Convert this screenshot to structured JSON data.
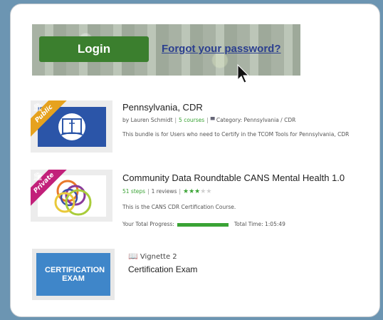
{
  "banner": {
    "login_label": "Login",
    "forgot_label": "Forgot your password?"
  },
  "courses": [
    {
      "ribbon": "Public",
      "title": "Pennsylvania, CDR",
      "author": "by Lauren Schmidt",
      "courses_count": "5 courses",
      "category": "Category: Pennsylvania / CDR",
      "description": "This bundle is for Users who need to Certify in the TCOM Tools for Pennsylvania, CDR"
    },
    {
      "ribbon": "Private",
      "title": "Community Data Roundtable CANS Mental Health 1.0",
      "steps": "51 steps",
      "reviews": "1 reviews",
      "rating": 3,
      "rating_max": 5,
      "description": "This is the CANS CDR Certification Course.",
      "progress_label": "Your Total Progress:",
      "progress": 1.0,
      "time_label": "Total Time: 1:05:49"
    },
    {
      "thumb_text": "CERTIFICATION EXAM",
      "type_label": "Vignette 2",
      "title": "Certification Exam"
    }
  ],
  "colors": {
    "background": "#6c95b2",
    "login_green": "#3b7f2e",
    "accent_green": "#3aa335",
    "link_blue": "#2b3f8f",
    "public_ribbon": "#e6a21e",
    "private_ribbon": "#c2207a",
    "exam_blue": "#3f86c9"
  }
}
